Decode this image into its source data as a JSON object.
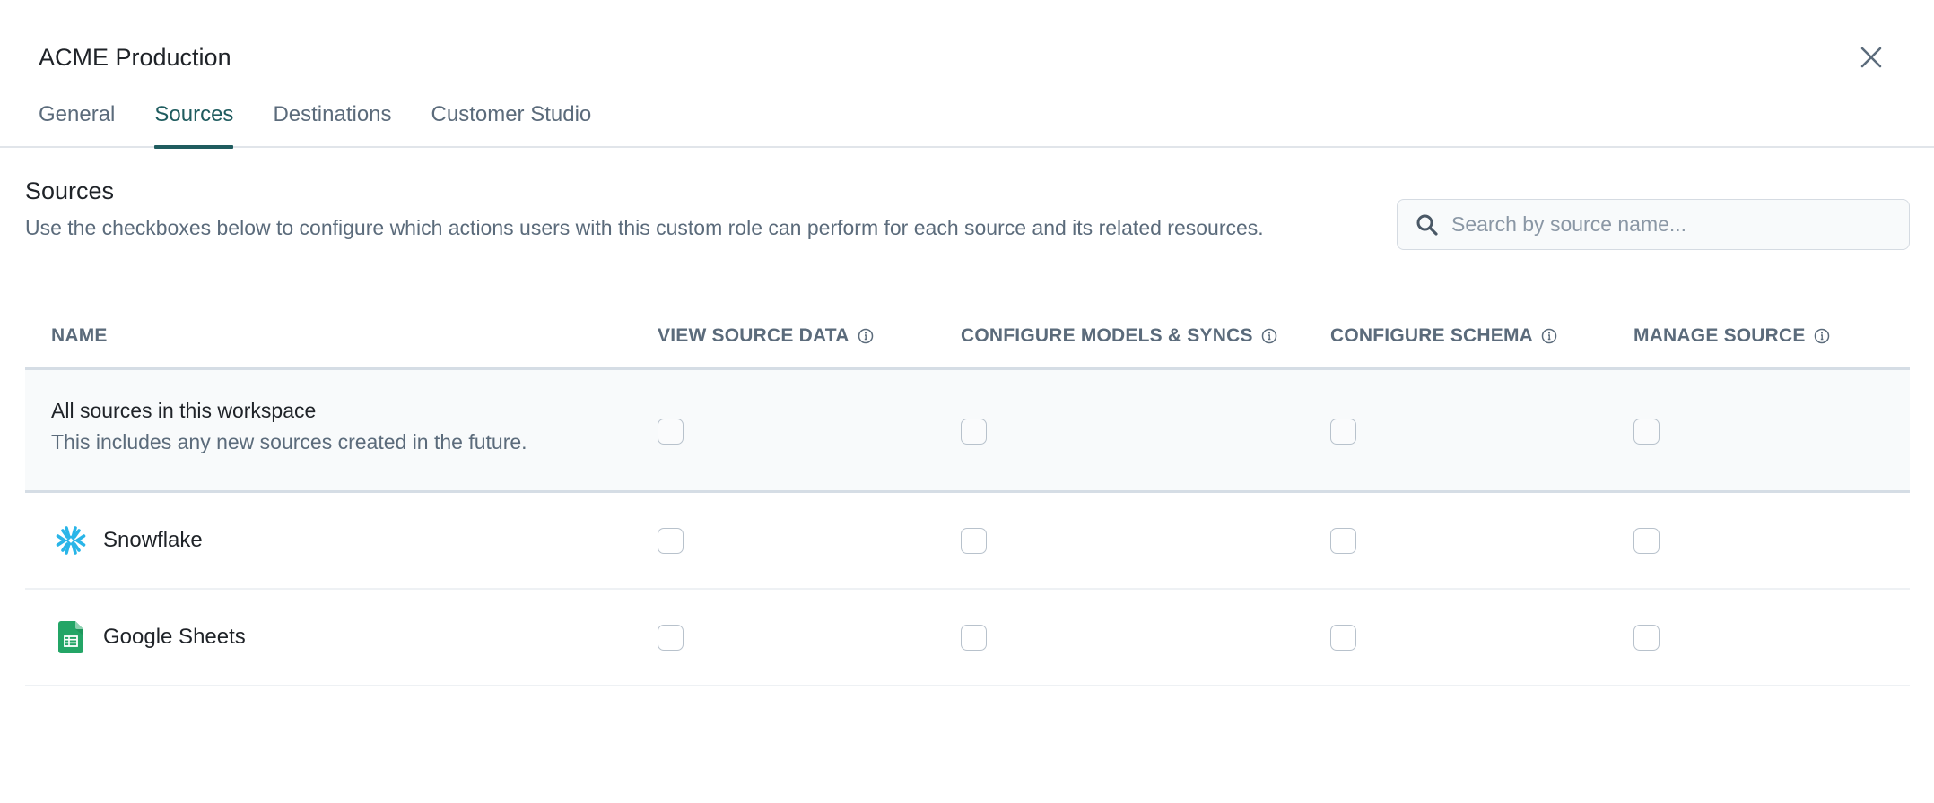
{
  "window": {
    "title": "ACME Production",
    "close_icon": "close-icon"
  },
  "tabs": [
    {
      "label": "General",
      "active": false
    },
    {
      "label": "Sources",
      "active": true
    },
    {
      "label": "Destinations",
      "active": false
    },
    {
      "label": "Customer Studio",
      "active": false
    }
  ],
  "section": {
    "title": "Sources",
    "description": "Use the checkboxes below to configure which actions users with this custom role can perform for each source and its related resources."
  },
  "search": {
    "placeholder": "Search by source name...",
    "value": "",
    "icon": "search-icon"
  },
  "table": {
    "columns": [
      {
        "label": "NAME",
        "info": false
      },
      {
        "label": "VIEW SOURCE DATA",
        "info": true
      },
      {
        "label": "CONFIGURE MODELS & SYNCS",
        "info": true
      },
      {
        "label": "CONFIGURE SCHEMA",
        "info": true
      },
      {
        "label": "MANAGE SOURCE",
        "info": true
      }
    ],
    "all_row": {
      "title": "All sources in this workspace",
      "subtitle": "This includes any new sources created in the future.",
      "checked": [
        false,
        false,
        false,
        false
      ]
    },
    "rows": [
      {
        "name": "Snowflake",
        "icon": "snowflake-icon",
        "checked": [
          false,
          false,
          false,
          false
        ]
      },
      {
        "name": "Google Sheets",
        "icon": "google-sheets-icon",
        "checked": [
          false,
          false,
          false,
          false
        ]
      }
    ]
  },
  "colors": {
    "accent": "#1f5c5f",
    "muted_text": "#5b6b7b",
    "snowflake": "#29b5e8",
    "google_sheets": "#23a566"
  }
}
